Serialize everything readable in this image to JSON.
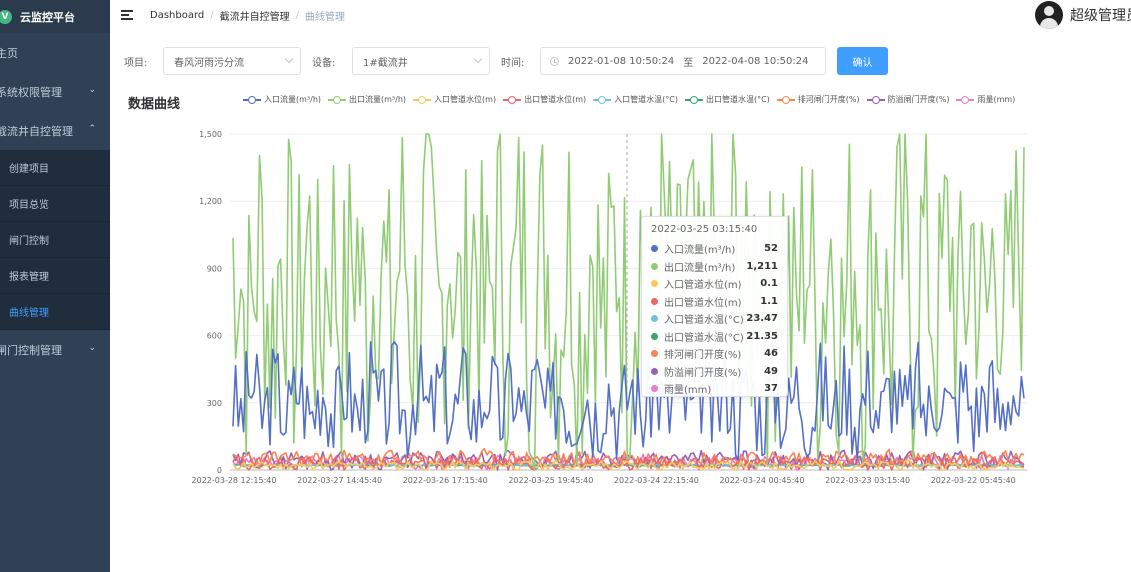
{
  "app": {
    "title": "云监控平台",
    "logo_letter": "V"
  },
  "sidebar": {
    "items": [
      {
        "label": "主页"
      },
      {
        "label": "系统权限管理",
        "chevron": "⌄"
      },
      {
        "label": "截流井自控管理",
        "chevron": "⌃"
      },
      {
        "label": "闸门控制管理",
        "chevron": "⌄"
      }
    ],
    "submenu": [
      {
        "label": "创建项目"
      },
      {
        "label": "项目总览"
      },
      {
        "label": "闸门控制"
      },
      {
        "label": "报表管理"
      },
      {
        "label": "曲线管理"
      }
    ]
  },
  "breadcrumb": {
    "items": [
      "Dashboard",
      "截流井自控管理",
      "曲线管理"
    ],
    "separator": "/"
  },
  "user": {
    "name": "超级管理员"
  },
  "filters": {
    "project_label": "项目:",
    "project_value": "春风河雨污分流",
    "device_label": "设备:",
    "device_value": "1#截流井",
    "time_label": "时间:",
    "start": "2022-01-08 10:50:24",
    "range_sep": "至",
    "end": "2022-04-08 10:50:24",
    "confirm_label": "确认"
  },
  "chart_data": {
    "type": "line",
    "title": "数据曲线",
    "x_ticks": [
      "2022-03-28 12:15:40",
      "2022-03-27 14:45:40",
      "2022-03-26 17:15:40",
      "2022-03-25 19:45:40",
      "2022-03-24 22:15:40",
      "2022-03-24 00:45:40",
      "2022-03-23 03:15:40",
      "2022-03-22 05:45:40"
    ],
    "ylim": [
      0,
      1500
    ],
    "y_ticks": [
      "0",
      "300",
      "600",
      "900",
      "1,200",
      "1,500"
    ],
    "grid": true,
    "legend_position": "top",
    "series": [
      {
        "name": "入口流量(m³/h)",
        "color": "#5470c6",
        "base": 310,
        "amp": 220,
        "seed": 3
      },
      {
        "name": "出口流量(m³/h)",
        "color": "#91cc75",
        "base": 820,
        "amp": 680,
        "seed": 7
      },
      {
        "name": "入口管道水位(m)",
        "color": "#fac858",
        "base": 20,
        "amp": 18,
        "seed": 11
      },
      {
        "name": "出口管道水位(m)",
        "color": "#ee6666",
        "base": 30,
        "amp": 25,
        "seed": 13
      },
      {
        "name": "入口管道水温(°C)",
        "color": "#73c0de",
        "base": 23,
        "amp": 3,
        "seed": 17
      },
      {
        "name": "出口管道水温(°C)",
        "color": "#3ba272",
        "base": 21,
        "amp": 3,
        "seed": 19
      },
      {
        "name": "排河闸门开度(%)",
        "color": "#fc8452",
        "base": 50,
        "amp": 35,
        "seed": 23
      },
      {
        "name": "防溢闸门开度(%)",
        "color": "#9a60b4",
        "base": 45,
        "amp": 35,
        "seed": 29
      },
      {
        "name": "雨量(mm)",
        "color": "#ea7ccc",
        "base": 35,
        "amp": 28,
        "seed": 31
      }
    ]
  },
  "tooltip": {
    "time": "2022-03-25 03:15:40",
    "rows": [
      {
        "name": "入口流量(m³/h)",
        "value": "52",
        "color": "#5470c6"
      },
      {
        "name": "出口流量(m³/h)",
        "value": "1,211",
        "color": "#91cc75"
      },
      {
        "name": "入口管道水位(m)",
        "value": "0.1",
        "color": "#fac858"
      },
      {
        "name": "出口管道水位(m)",
        "value": "1.1",
        "color": "#ee6666"
      },
      {
        "name": "入口管道水温(°C)",
        "value": "23.47",
        "color": "#73c0de"
      },
      {
        "name": "出口管道水温(°C)",
        "value": "21.35",
        "color": "#3ba272"
      },
      {
        "name": "排河闸门开度(%)",
        "value": "46",
        "color": "#fc8452"
      },
      {
        "name": "防溢闸门开度(%)",
        "value": "49",
        "color": "#9a60b4"
      },
      {
        "name": "雨量(mm)",
        "value": "37",
        "color": "#ea7ccc"
      }
    ]
  }
}
